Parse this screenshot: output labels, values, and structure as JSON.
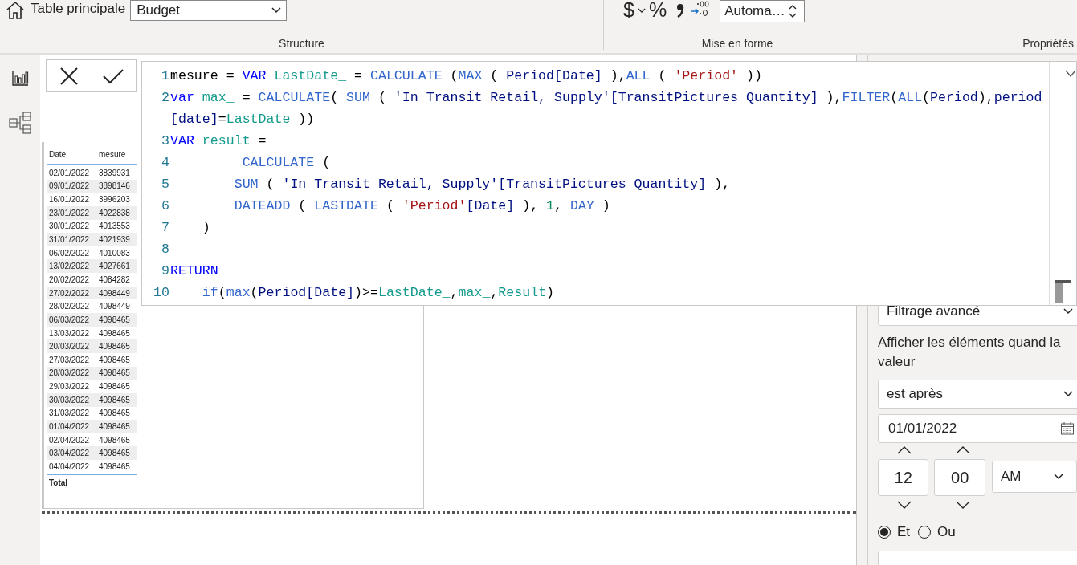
{
  "ribbon": {
    "home_label": "Table principale",
    "table_select": "Budget",
    "currency_symbol": "$",
    "percent_symbol": "%",
    "format_select": "Automa…",
    "groups": [
      "Structure",
      "Mise en forme",
      "Propriétés"
    ]
  },
  "formula_editor": {
    "lines": [
      {
        "number": "1",
        "tokens": [
          {
            "kind": "plain",
            "text": "mesure = "
          },
          {
            "kind": "keyword",
            "text": "VAR "
          },
          {
            "kind": "variable",
            "text": "LastDate_"
          },
          {
            "kind": "plain",
            "text": " = "
          },
          {
            "kind": "function",
            "text": "CALCULATE"
          },
          {
            "kind": "plain",
            "text": " ("
          },
          {
            "kind": "function",
            "text": "MAX"
          },
          {
            "kind": "plain",
            "text": " ( "
          },
          {
            "kind": "column",
            "text": "Period[Date]"
          },
          {
            "kind": "plain",
            "text": " ),"
          },
          {
            "kind": "function",
            "text": "ALL"
          },
          {
            "kind": "plain",
            "text": " ( "
          },
          {
            "kind": "string",
            "text": "'Period'"
          },
          {
            "kind": "plain",
            "text": " ))"
          }
        ]
      },
      {
        "number": "2",
        "tokens": [
          {
            "kind": "keyword",
            "text": "var "
          },
          {
            "kind": "variable",
            "text": "max_"
          },
          {
            "kind": "plain",
            "text": " = "
          },
          {
            "kind": "function",
            "text": "CALCULATE"
          },
          {
            "kind": "plain",
            "text": "( "
          },
          {
            "kind": "function",
            "text": "SUM"
          },
          {
            "kind": "plain",
            "text": " ( "
          },
          {
            "kind": "column",
            "text": "'In Transit Retail, Supply'[TransitPictures Quantity]"
          },
          {
            "kind": "plain",
            "text": " ),"
          },
          {
            "kind": "function",
            "text": "FILTER"
          },
          {
            "kind": "plain",
            "text": "("
          },
          {
            "kind": "function",
            "text": "ALL"
          },
          {
            "kind": "plain",
            "text": "("
          },
          {
            "kind": "column",
            "text": "Period"
          },
          {
            "kind": "plain",
            "text": "),"
          },
          {
            "kind": "column",
            "text": "period[date]"
          },
          {
            "kind": "plain",
            "text": "="
          },
          {
            "kind": "variable",
            "text": "LastDate_"
          },
          {
            "kind": "plain",
            "text": "))"
          }
        ]
      },
      {
        "number": "3",
        "tokens": [
          {
            "kind": "keyword",
            "text": "VAR "
          },
          {
            "kind": "variable",
            "text": "result"
          },
          {
            "kind": "plain",
            "text": " ="
          }
        ]
      },
      {
        "number": "4",
        "tokens": [
          {
            "kind": "function",
            "text": "         CALCULATE"
          },
          {
            "kind": "plain",
            "text": " ("
          }
        ]
      },
      {
        "number": "5",
        "tokens": [
          {
            "kind": "function",
            "text": "        SUM"
          },
          {
            "kind": "plain",
            "text": " ( "
          },
          {
            "kind": "column",
            "text": "'In Transit Retail, Supply'[TransitPictures Quantity]"
          },
          {
            "kind": "plain",
            "text": " ),"
          }
        ]
      },
      {
        "number": "6",
        "tokens": [
          {
            "kind": "function",
            "text": "        DATEADD"
          },
          {
            "kind": "plain",
            "text": " ( "
          },
          {
            "kind": "function",
            "text": "LASTDATE"
          },
          {
            "kind": "plain",
            "text": " ( "
          },
          {
            "kind": "string",
            "text": "'Period'"
          },
          {
            "kind": "column",
            "text": "[Date]"
          },
          {
            "kind": "plain",
            "text": " ), "
          },
          {
            "kind": "number",
            "text": "1"
          },
          {
            "kind": "plain",
            "text": ", "
          },
          {
            "kind": "function",
            "text": "DAY"
          },
          {
            "kind": "plain",
            "text": " )"
          }
        ]
      },
      {
        "number": "7",
        "tokens": [
          {
            "kind": "plain",
            "text": "    )"
          }
        ]
      },
      {
        "number": "8"
      },
      {
        "number": "9",
        "tokens": [
          {
            "kind": "keyword",
            "text": "RETURN"
          }
        ]
      },
      {
        "number": "10",
        "tokens": [
          {
            "kind": "function",
            "text": "    if"
          },
          {
            "kind": "plain",
            "text": "("
          },
          {
            "kind": "function",
            "text": "max"
          },
          {
            "kind": "plain",
            "text": "("
          },
          {
            "kind": "column",
            "text": "Period[Date]"
          },
          {
            "kind": "plain",
            "text": ")>="
          },
          {
            "kind": "variable",
            "text": "LastDate_"
          },
          {
            "kind": "plain",
            "text": ","
          },
          {
            "kind": "variable",
            "text": "max_"
          },
          {
            "kind": "plain",
            "text": ","
          },
          {
            "kind": "variable",
            "text": "Result"
          },
          {
            "kind": "plain",
            "text": ")"
          }
        ]
      }
    ]
  },
  "table_visual": {
    "columns": [
      "Date",
      "mesure"
    ],
    "rows": [
      [
        "02/01/2022",
        "3839931"
      ],
      [
        "09/01/2022",
        "3898146"
      ],
      [
        "16/01/2022",
        "3996203"
      ],
      [
        "23/01/2022",
        "4022838"
      ],
      [
        "30/01/2022",
        "4013553"
      ],
      [
        "31/01/2022",
        "4021939"
      ],
      [
        "06/02/2022",
        "4010083"
      ],
      [
        "13/02/2022",
        "4027661"
      ],
      [
        "20/02/2022",
        "4084282"
      ],
      [
        "27/02/2022",
        "4098449"
      ],
      [
        "28/02/2022",
        "4098449"
      ],
      [
        "06/03/2022",
        "4098465"
      ],
      [
        "13/03/2022",
        "4098465"
      ],
      [
        "20/03/2022",
        "4098465"
      ],
      [
        "27/03/2022",
        "4098465"
      ],
      [
        "28/03/2022",
        "4098465"
      ],
      [
        "29/03/2022",
        "4098465"
      ],
      [
        "30/03/2022",
        "4098465"
      ],
      [
        "31/03/2022",
        "4098465"
      ],
      [
        "01/04/2022",
        "4098465"
      ],
      [
        "02/04/2022",
        "4098465"
      ],
      [
        "03/04/2022",
        "4098465"
      ],
      [
        "04/04/2022",
        "4098465"
      ]
    ],
    "total_label": "Total"
  },
  "filter_pane": {
    "filter_type": "Filtrage avancé",
    "condition_label": "Afficher les éléments quand la valeur",
    "operator": "est après",
    "date": "01/01/2022",
    "hour": "12",
    "minute": "00",
    "meridiem": "AM",
    "logic": [
      {
        "label": "Et",
        "selected": true
      },
      {
        "label": "Ou",
        "selected": false
      }
    ]
  }
}
